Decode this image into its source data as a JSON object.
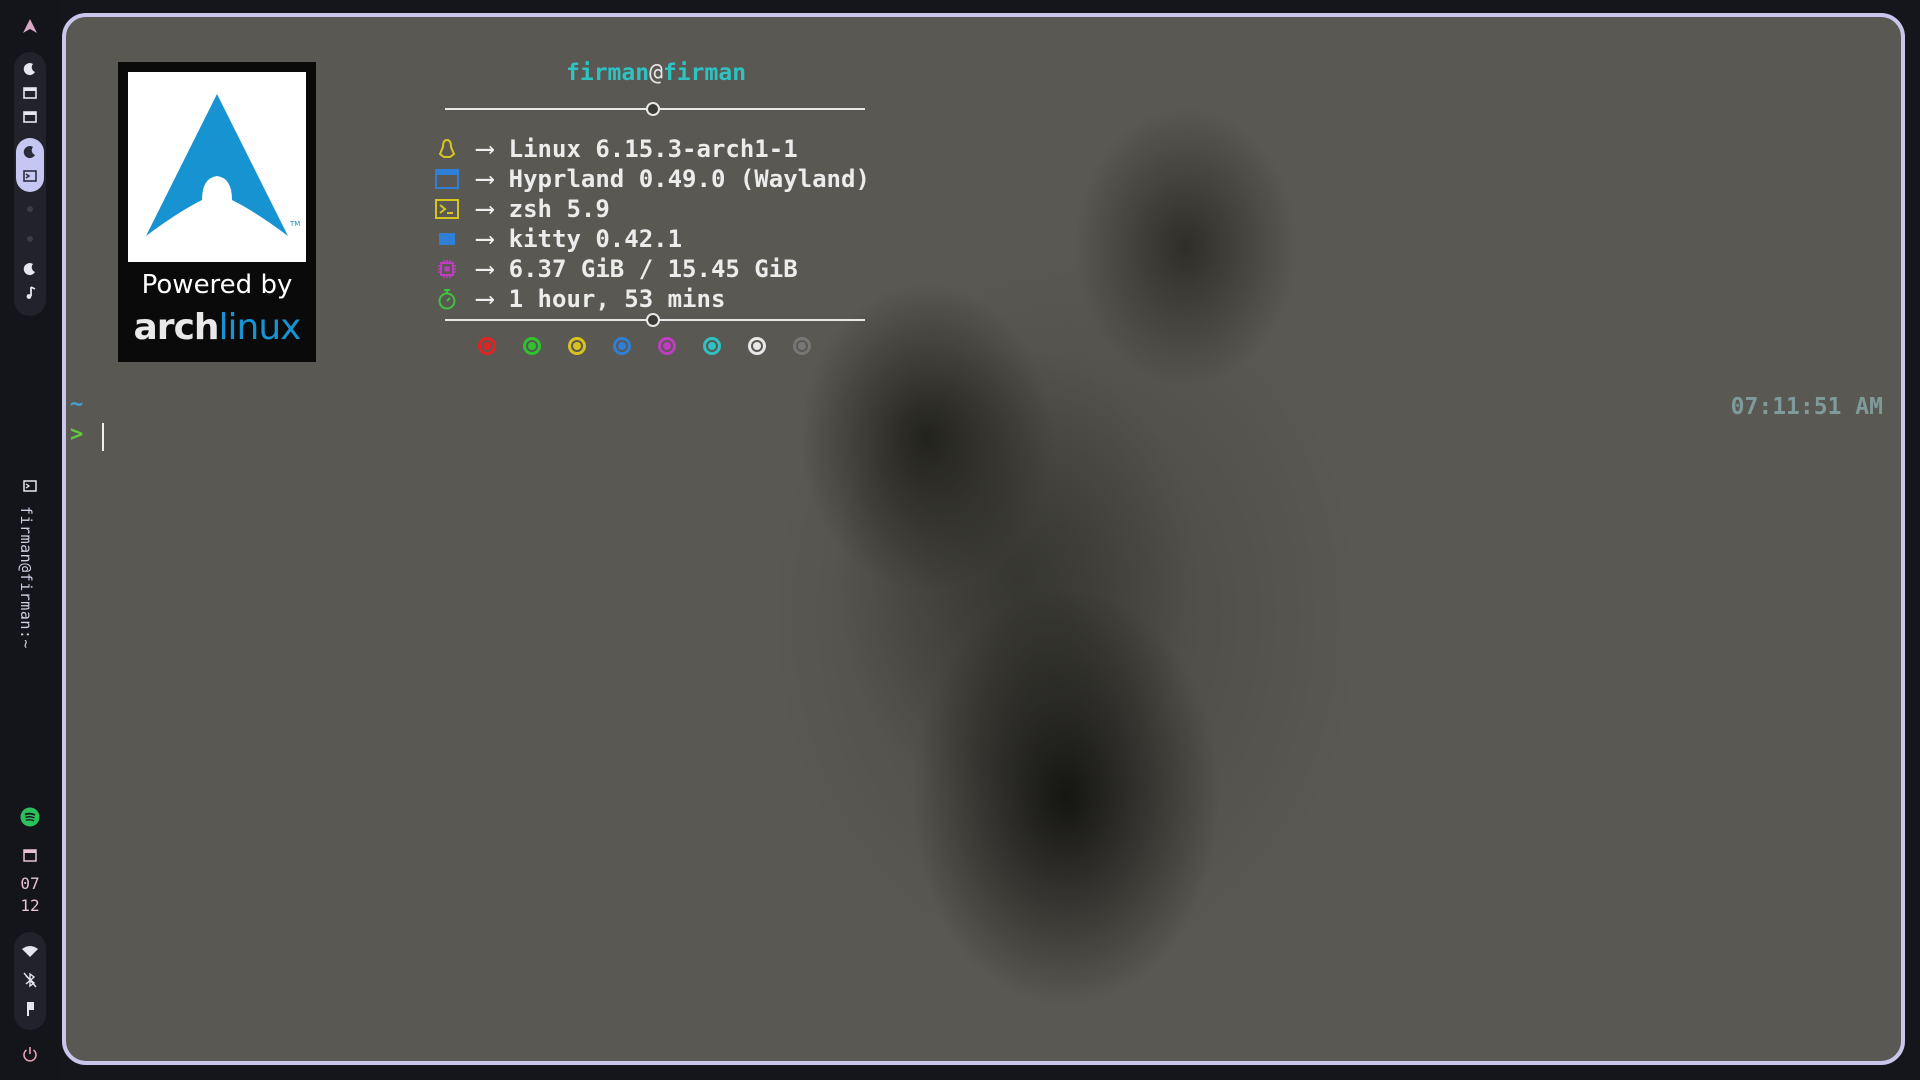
{
  "sidebar": {
    "logo_icon": "arch-logo-icon",
    "window_title": "firman@firman:~",
    "date_month": "07",
    "date_day": "12",
    "icons": [
      "moon-icon",
      "window-icon",
      "window-icon",
      "moon-icon",
      "terminal-icon",
      "moon-icon",
      "music-note-icon",
      "terminal-icon",
      "spotify-icon",
      "calendar-icon",
      "wifi-icon",
      "bluetooth-off-icon",
      "pin-icon",
      "power-icon"
    ],
    "accent": "#c6c6f2"
  },
  "terminal": {
    "user": "firman",
    "at": "@",
    "host": "firman",
    "logo": {
      "powered": "Powered by",
      "word_a": "arch",
      "word_b": "linux",
      "arch_blue": "#1793d1"
    },
    "info": [
      {
        "icon": "linux-tux-icon",
        "color": "#d7c51f",
        "value": "Linux 6.15.3-arch1-1"
      },
      {
        "icon": "window-manager-icon",
        "color": "#2f7fd6",
        "value": "Hyprland 0.49.0 (Wayland)"
      },
      {
        "icon": "shell-prompt-icon",
        "color": "#d7c51f",
        "value": "zsh 5.9"
      },
      {
        "icon": "terminal-app-icon",
        "color": "#2f7fd6",
        "value": "kitty 0.42.1"
      },
      {
        "icon": "memory-chip-icon",
        "color": "#c03cc0",
        "value": "6.37 GiB / 15.45 GiB"
      },
      {
        "icon": "stopwatch-icon",
        "color": "#3fc23f",
        "value": "1 hour, 53 mins"
      }
    ],
    "arrow": "⟶",
    "palette": [
      "#e02424",
      "#2ec22e",
      "#d8c21c",
      "#2f7fd6",
      "#c03cc0",
      "#2ec2c2",
      "#e8e8e8",
      "#777777"
    ],
    "prompt_dir": "~",
    "prompt_symbol": ">",
    "clock": "07:11:51 AM"
  }
}
